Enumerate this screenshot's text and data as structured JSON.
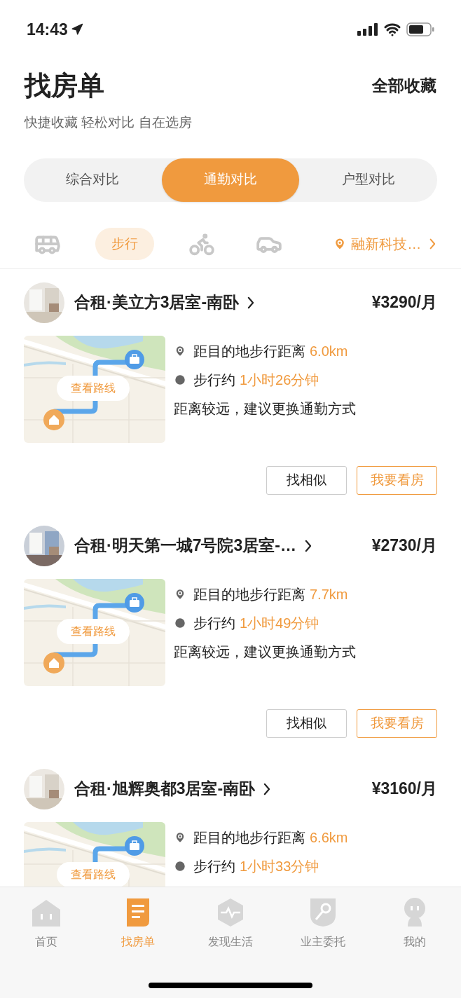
{
  "status_bar": {
    "time": "14:43"
  },
  "header": {
    "title": "找房单",
    "action": "全部收藏",
    "subtitle": "快捷收藏 轻松对比 自在选房"
  },
  "segments": [
    {
      "label": "综合对比",
      "selected": false
    },
    {
      "label": "通勤对比",
      "selected": true
    },
    {
      "label": "户型对比",
      "selected": false
    }
  ],
  "modes": [
    {
      "kind": "bus",
      "selected": false
    },
    {
      "label": "步行",
      "selected": true
    },
    {
      "kind": "bike",
      "selected": false
    },
    {
      "kind": "car",
      "selected": false
    }
  ],
  "destination": "融新科技…",
  "listings": [
    {
      "title": "合租·美立方3居室-南卧",
      "price": "¥3290/月",
      "map_button": "查看路线",
      "distance_label": "距目的地步行距离",
      "distance": "6.0km",
      "time_label": "步行约",
      "time": "1小时26分钟",
      "note": "距离较远，建议更换通勤方式",
      "buttons": [
        "找相似",
        "我要看房"
      ]
    },
    {
      "title": "合租·明天第一城7号院3居室-…",
      "price": "¥2730/月",
      "map_button": "查看路线",
      "distance_label": "距目的地步行距离",
      "distance": "7.7km",
      "time_label": "步行约",
      "time": "1小时49分钟",
      "note": "距离较远，建议更换通勤方式",
      "buttons": [
        "找相似",
        "我要看房"
      ]
    },
    {
      "title": "合租·旭辉奥都3居室-南卧",
      "price": "¥3160/月",
      "map_button": "查看路线",
      "distance_label": "距目的地步行距离",
      "distance": "6.6km",
      "time_label": "步行约",
      "time": "1小时33分钟"
    }
  ],
  "tab_bar": [
    {
      "kind": "home",
      "label": "首页",
      "selected": false
    },
    {
      "kind": "list",
      "label": "找房单",
      "selected": true
    },
    {
      "kind": "discover",
      "label": "发现生活",
      "selected": false
    },
    {
      "kind": "owner",
      "label": "业主委托",
      "selected": false
    },
    {
      "kind": "me",
      "label": "我的",
      "selected": false
    }
  ]
}
